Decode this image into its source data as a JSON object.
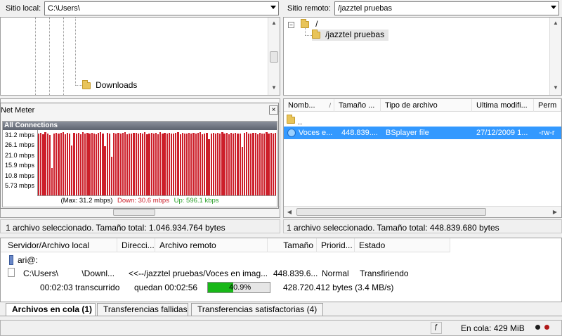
{
  "local": {
    "label": "Sitio local:",
    "path": "C:\\Users\\",
    "tree_item": "Downloads"
  },
  "remote": {
    "label": "Sitio remoto:",
    "path": "/jazztel pruebas",
    "tree_root": "/",
    "tree_child": "/jazztel pruebas",
    "columns": [
      "Nomb...",
      "Tamaño ...",
      "Tipo de archivo",
      "Ultima modifi...",
      "Perm"
    ],
    "parent_dir": "..",
    "file": {
      "name": "Voces e...",
      "size": "448.839....",
      "type": "BSplayer file",
      "modified": "27/12/2009 1...",
      "perms": "-rw-r"
    }
  },
  "netmeter": {
    "title": "Net Meter",
    "header": "All Connections",
    "y_ticks": [
      "31.2 mbps",
      "26.1 mbps",
      "21.0 mbps",
      "15.9 mbps",
      "10.8 mbps",
      "5.73 mbps"
    ],
    "footer_max": "(Max: 31.2 mbps)",
    "footer_down": "Down: 30.6 mbps",
    "footer_up": "Up: 596.1 kbps",
    "color_down": "#cc1f2a",
    "color_up": "#2aa02a"
  },
  "chart_data": {
    "type": "bar",
    "title": "All Connections",
    "ylim": [
      0,
      31.2
    ],
    "values": [
      29.5,
      29.8,
      29.2,
      30.1,
      29.6,
      28.9,
      13.0,
      29.7,
      30.0,
      29.4,
      29.9,
      30.2,
      29.1,
      29.8,
      29.6,
      24.0,
      30.0,
      29.5,
      29.8,
      29.3,
      30.1,
      29.7,
      29.9,
      29.4,
      30.0,
      29.6,
      29.2,
      29.8,
      30.1,
      29.5,
      23.5,
      29.9,
      29.7,
      18.5,
      30.0,
      29.4,
      29.8,
      29.6,
      29.9,
      30.2,
      29.3,
      29.7,
      29.5,
      30.0,
      29.8,
      29.4,
      29.9,
      29.6,
      30.1,
      29.2,
      29.7,
      30.0,
      29.5,
      29.8,
      29.3,
      30.1,
      29.6,
      29.9,
      29.4,
      30.0,
      29.7,
      29.5,
      29.8,
      30.2,
      29.3,
      29.9,
      29.6,
      29.4,
      30.0,
      29.7,
      29.8,
      29.5,
      29.9,
      30.1,
      29.2,
      29.6,
      29.8,
      27.0,
      29.7,
      30.0,
      29.4,
      29.9,
      29.6,
      30.2,
      29.5,
      29.8,
      29.3,
      30.0,
      29.7,
      29.9,
      29.4,
      29.6,
      23.0,
      29.8,
      30.1,
      29.5,
      29.7,
      29.9,
      30.0,
      29.3,
      29.8,
      29.6,
      29.4,
      30.2,
      29.5,
      29.9,
      29.7,
      29.8
    ]
  },
  "local_status": "1 archivo seleccionado. Tamaño total: 1.046.934.764 bytes",
  "remote_status": "1 archivo seleccionado. Tamaño total: 448.839.680 bytes",
  "queue": {
    "columns": [
      "Servidor/Archivo local",
      "Direcci...",
      "Archivo remoto",
      "Tamaño",
      "Priorid...",
      "Estado"
    ],
    "server": "ari@:",
    "local_file": "C:\\Users\\          \\Downl...",
    "direction": "<<--",
    "remote_file": "/jazztel pruebas/Voces en imag...",
    "size": "448.839.6...",
    "priority": "Normal",
    "state": "Transfiriendo",
    "elapsed": "00:02:03 transcurrido",
    "remaining": "quedan 00:02:56",
    "progress_pct": 40.9,
    "progress_label": "40.9%",
    "bytes_info": "428.720.412 bytes (3.4 MB/s)",
    "progress_color": "#18b818"
  },
  "tabs": [
    "Archivos en cola (1)",
    "Transferencias fallidas",
    "Transferencias satisfactorias (4)"
  ],
  "statusbar": {
    "queue_text": "En cola: 429 MiB"
  }
}
